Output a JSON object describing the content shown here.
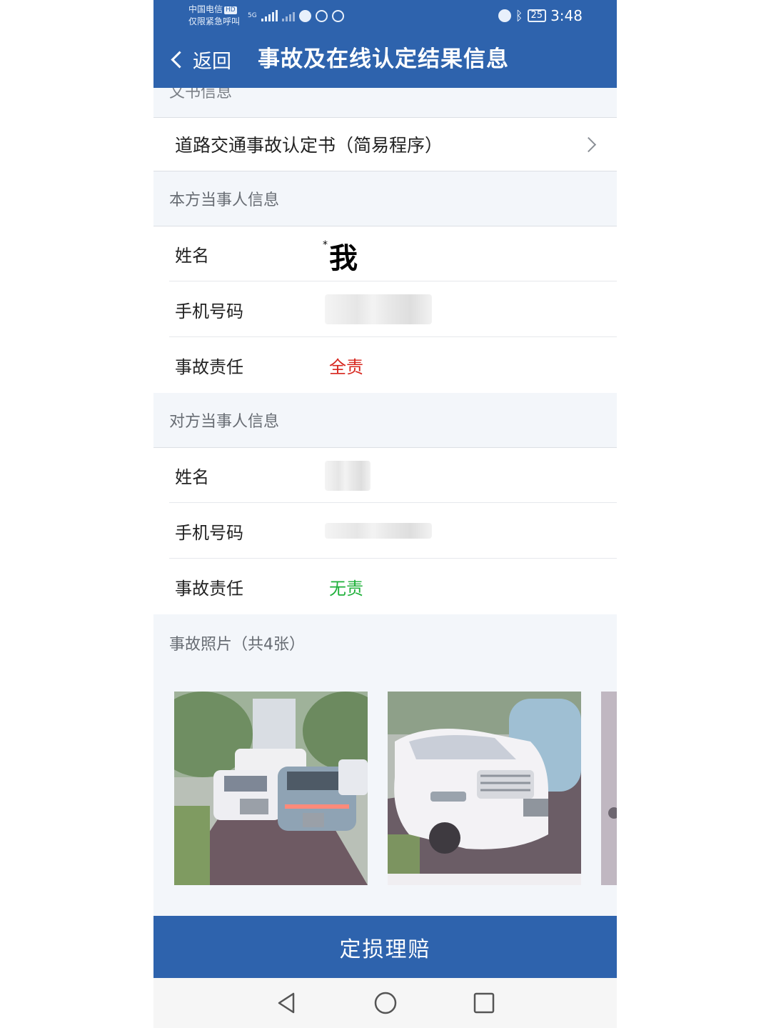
{
  "status_bar": {
    "carrier": "中国电信",
    "hd": "HD",
    "emergency": "仅限紧急呼叫",
    "network": "5G",
    "battery": "25",
    "time": "3:48"
  },
  "header": {
    "back_label": "返回",
    "title": "事故及在线认定结果信息"
  },
  "sections": {
    "document_label": "文书信息",
    "document_item": "道路交通事故认定书（简易程序）",
    "own_party_label": "本方当事人信息",
    "other_party_label": "对方当事人信息",
    "photos_label": "事故照片（共4张）"
  },
  "own_party": {
    "name_key": "姓名",
    "name_prefix": "*",
    "name_value": "我",
    "phone_key": "手机号码",
    "responsibility_key": "事故责任",
    "responsibility_value": "全责"
  },
  "other_party": {
    "name_key": "姓名",
    "phone_key": "手机号码",
    "responsibility_key": "事故责任",
    "responsibility_value": "无责"
  },
  "colors": {
    "brand": "#2e63ad",
    "full_responsibility": "#d7261e",
    "no_responsibility": "#1fb03a"
  },
  "actions": {
    "claim_button": "定损理赔"
  },
  "icons": {
    "back": "chevron-left-icon",
    "document_open": "chevron-right-icon",
    "nav_back": "triangle-back-icon",
    "nav_home": "circle-home-icon",
    "nav_recent": "square-recent-icon"
  }
}
